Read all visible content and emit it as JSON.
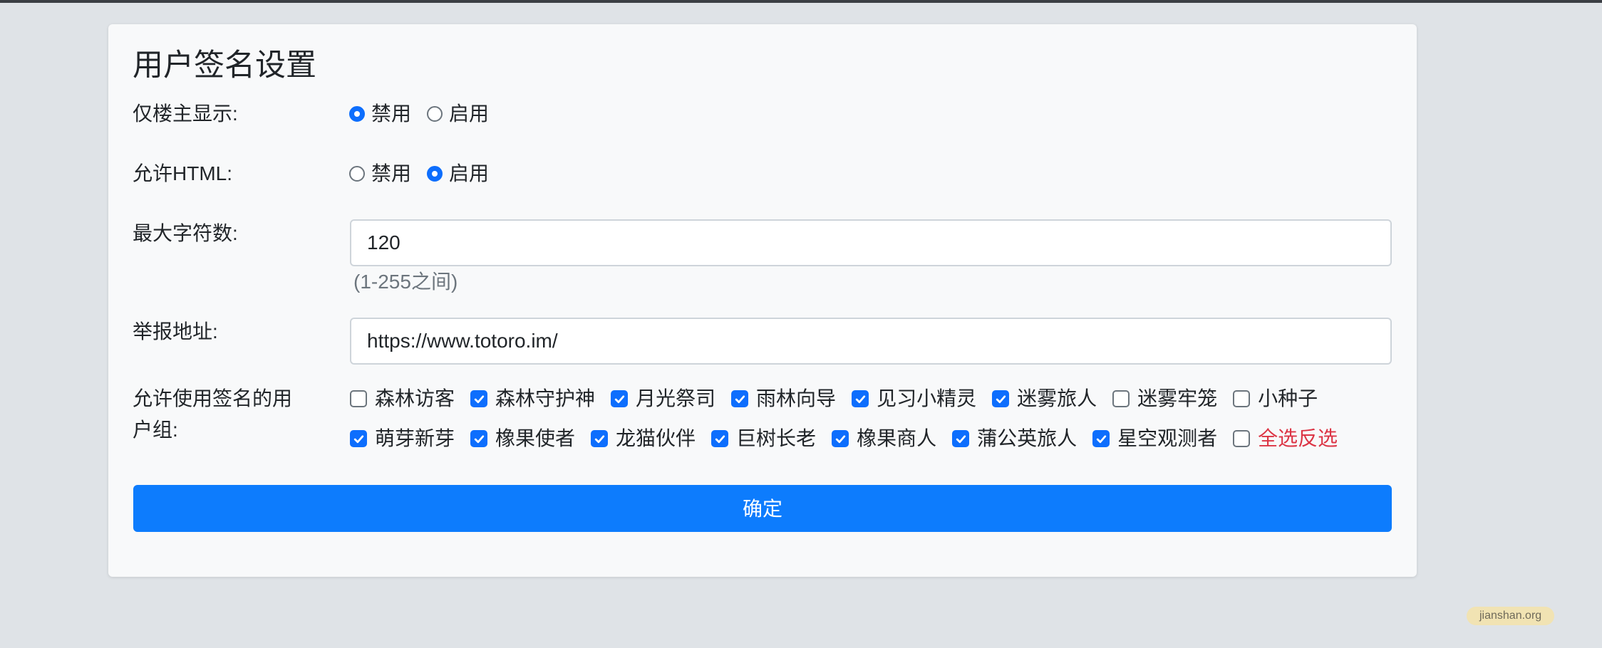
{
  "page": {
    "title": "用户签名设置"
  },
  "colors": {
    "accent": "#0d6efd",
    "button": "#0d7cfd",
    "danger": "#dc3545",
    "page_bg": "#dfe3e7"
  },
  "fields": {
    "owner_only": {
      "label": "仅楼主显示:",
      "options": [
        {
          "label": "禁用",
          "checked": true
        },
        {
          "label": "启用",
          "checked": false
        }
      ]
    },
    "allow_html": {
      "label": "允许HTML:",
      "options": [
        {
          "label": "禁用",
          "checked": false
        },
        {
          "label": "启用",
          "checked": true
        }
      ]
    },
    "max_chars": {
      "label": "最大字符数:",
      "value": "120",
      "hint": "(1-255之间)"
    },
    "report_url": {
      "label": "举报地址:",
      "value": "https://www.totoro.im/"
    },
    "user_groups": {
      "label_line1": "允许使用签名的用",
      "label_line2": "户组:",
      "row1": [
        {
          "label": "森林访客",
          "checked": false
        },
        {
          "label": "森林守护神",
          "checked": true
        },
        {
          "label": "月光祭司",
          "checked": true
        },
        {
          "label": "雨林向导",
          "checked": true
        },
        {
          "label": "见习小精灵",
          "checked": true
        },
        {
          "label": "迷雾旅人",
          "checked": true
        },
        {
          "label": "迷雾牢笼",
          "checked": false
        },
        {
          "label": "小种子",
          "checked": false
        }
      ],
      "row2": [
        {
          "label": "萌芽新芽",
          "checked": true
        },
        {
          "label": "橡果使者",
          "checked": true
        },
        {
          "label": "龙猫伙伴",
          "checked": true
        },
        {
          "label": "巨树长老",
          "checked": true
        },
        {
          "label": "橡果商人",
          "checked": true
        },
        {
          "label": "蒲公英旅人",
          "checked": true
        },
        {
          "label": "星空观测者",
          "checked": true
        },
        {
          "label": "全选反选",
          "checked": false
        }
      ]
    }
  },
  "submit_label": "确定",
  "watermark": "jianshan.org"
}
